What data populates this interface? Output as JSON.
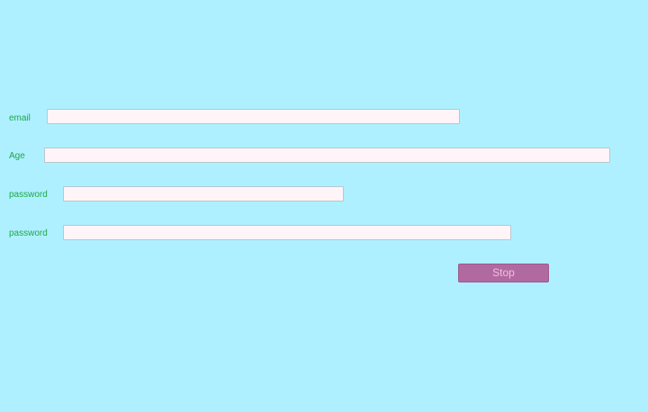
{
  "form": {
    "fields": [
      {
        "label": "email",
        "value": "",
        "placeholder": ""
      },
      {
        "label": "Age",
        "value": "",
        "placeholder": ""
      },
      {
        "label": "password",
        "value": "",
        "placeholder": ""
      },
      {
        "label": "password",
        "value": "",
        "placeholder": ""
      }
    ],
    "submit_label": "Stop"
  },
  "colors": {
    "background": "#aef0ff",
    "label_text": "#1fa84a",
    "field_background": "#fff5f8",
    "button_background": "#b06aa0",
    "button_text": "#f0c0dc"
  }
}
